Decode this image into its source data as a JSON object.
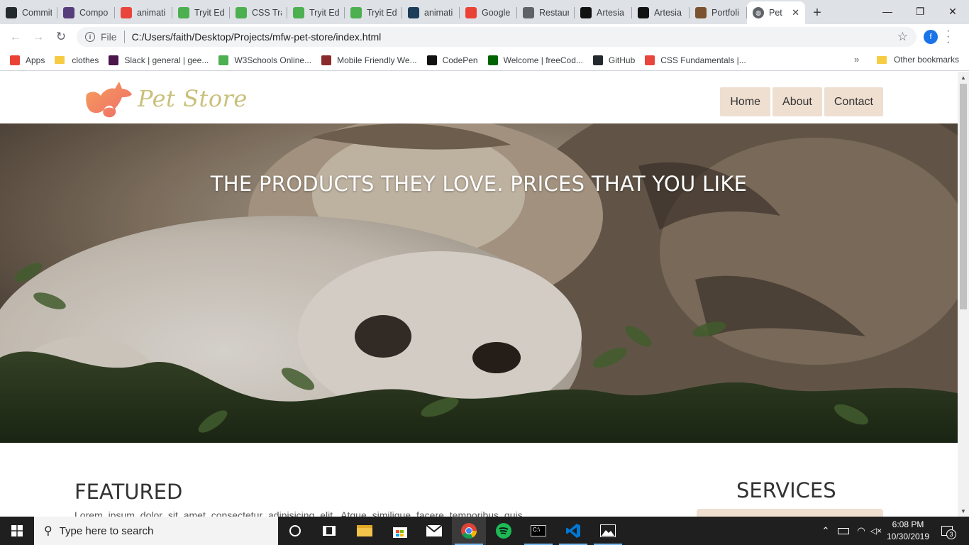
{
  "browser": {
    "tabs": [
      {
        "label": "Commit",
        "icon": "github-icon",
        "color": "#24292e"
      },
      {
        "label": "Compo",
        "icon": "bootstrap-icon",
        "color": "#563d7c"
      },
      {
        "label": "animati",
        "icon": "asterisk-icon",
        "color": "#e8453c"
      },
      {
        "label": "Tryit Ed",
        "icon": "w3schools-icon",
        "color": "#4caf50"
      },
      {
        "label": "CSS Tra",
        "icon": "w3schools-icon",
        "color": "#4caf50"
      },
      {
        "label": "Tryit Ed",
        "icon": "w3schools-icon",
        "color": "#4caf50"
      },
      {
        "label": "Tryit Ed",
        "icon": "w3schools-icon",
        "color": "#4caf50"
      },
      {
        "label": "animati",
        "icon": "whale-icon",
        "color": "#1c3d5a"
      },
      {
        "label": "Google",
        "icon": "google-icon",
        "color": "#ea4335"
      },
      {
        "label": "Restaur",
        "icon": "globe-icon",
        "color": "#5f6368"
      },
      {
        "label": "Artesia",
        "icon": "artesia-icon",
        "color": "#111111"
      },
      {
        "label": "Artesia",
        "icon": "artesia-icon",
        "color": "#111111"
      },
      {
        "label": "Portfoli",
        "icon": "portfolio-icon",
        "color": "#7a5230"
      }
    ],
    "active_tab": {
      "label": "Pet",
      "icon": "globe-icon"
    },
    "new_tab_symbol": "+",
    "address": {
      "scheme": "File",
      "url": "C:/Users/faith/Desktop/Projects/mfw-pet-store/index.html"
    },
    "profile_initial": "f",
    "bookmarks": [
      {
        "label": "Apps",
        "icon": "apps-grid-icon"
      },
      {
        "label": "clothes",
        "icon": "folder-icon"
      },
      {
        "label": "Slack | general | gee...",
        "icon": "slack-icon"
      },
      {
        "label": "W3Schools Online...",
        "icon": "w3schools-icon"
      },
      {
        "label": "Mobile Friendly We...",
        "icon": "mobile-icon"
      },
      {
        "label": "CodePen",
        "icon": "codepen-icon"
      },
      {
        "label": "Welcome | freeCod...",
        "icon": "freecodecamp-icon"
      },
      {
        "label": "GitHub",
        "icon": "github-icon"
      },
      {
        "label": "CSS Fundamentals |...",
        "icon": "css-icon"
      }
    ],
    "more_bookmarks": "»",
    "other_bookmarks": "Other bookmarks"
  },
  "site": {
    "logo_text": "Pet Store",
    "nav": [
      "Home",
      "About",
      "Contact"
    ],
    "hero_title": "THE PRODUCTS THEY LOVE. PRICES THAT YOU LIKE",
    "featured_title": "FEATURED",
    "featured_text": "Lorem ipsum dolor sit amet consectetur adipisicing elit. Atque similique facere temporibus quis",
    "services_title": "SERVICES",
    "accent_color": "#efdfd0",
    "logo_color": "#f08a5d"
  },
  "taskbar": {
    "search_placeholder": "Type here to search",
    "time": "6:08 PM",
    "date": "10/30/2019",
    "notification_count": "3"
  }
}
